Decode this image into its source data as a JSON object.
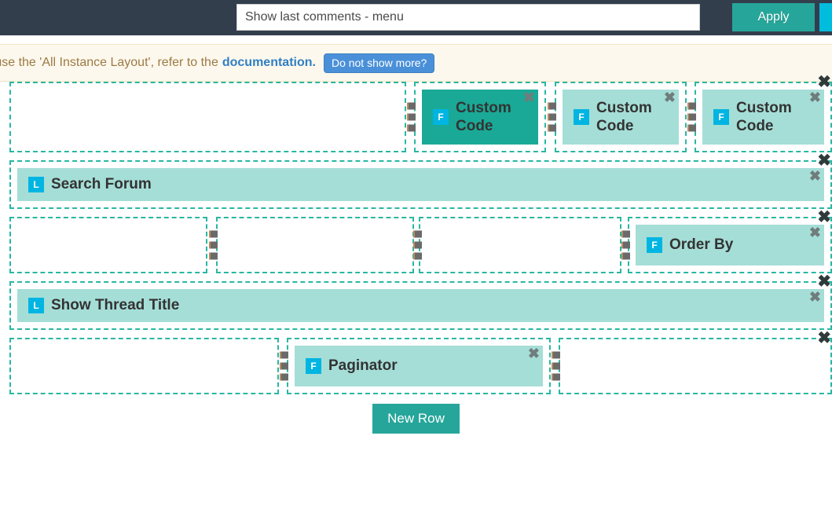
{
  "topbar": {
    "input_value": "Show last comments - menu",
    "input_placeholder": "",
    "apply_label": "Apply",
    "edge_button_label": ""
  },
  "notice": {
    "text": "o use the 'All Instance Layout', refer to the",
    "link_label": "documentation.",
    "dismiss_label": "Do not show more?"
  },
  "builder": {
    "new_row_label": "New Row",
    "close_glyph": "✖",
    "rows": [
      {
        "name": "row-1",
        "columns": [
          {
            "name": "column-empty",
            "widget": null
          },
          {
            "name": "column-custom-code-1",
            "widget": {
              "badge": "F",
              "label": "Custom Code",
              "selected": true
            }
          },
          {
            "name": "column-custom-code-2",
            "widget": {
              "badge": "F",
              "label": "Custom Code",
              "selected": false
            }
          },
          {
            "name": "column-custom-code-3",
            "widget": {
              "badge": "F",
              "label": "Custom Code",
              "selected": false
            }
          }
        ]
      },
      {
        "name": "row-2",
        "columns": [
          {
            "name": "column-search-forum",
            "widget": {
              "badge": "L",
              "label": "Search Forum",
              "selected": false
            }
          }
        ]
      },
      {
        "name": "row-3",
        "columns": [
          {
            "name": "column-empty",
            "widget": null
          },
          {
            "name": "column-empty",
            "widget": null
          },
          {
            "name": "column-empty",
            "widget": null
          },
          {
            "name": "column-order-by",
            "widget": {
              "badge": "F",
              "label": "Order By",
              "selected": false
            }
          }
        ]
      },
      {
        "name": "row-4",
        "columns": [
          {
            "name": "column-show-thread-title",
            "widget": {
              "badge": "L",
              "label": "Show Thread Title",
              "selected": false
            }
          }
        ]
      },
      {
        "name": "row-5",
        "columns": [
          {
            "name": "column-empty",
            "widget": null
          },
          {
            "name": "column-paginator",
            "widget": {
              "badge": "F",
              "label": "Paginator",
              "selected": false
            }
          },
          {
            "name": "column-empty",
            "widget": null
          }
        ]
      }
    ]
  },
  "colors": {
    "topbar_bg": "#333e4d",
    "apply_green": "#26a69a",
    "edge_cyan": "#00bcdd",
    "notice_bg": "#fdf8ed",
    "notice_text": "#9c7a45",
    "notice_link": "#2f7fc4",
    "notice_button": "#4a90d9",
    "dashed_border": "#2ab7a2",
    "widget_light": "#a5ded7",
    "widget_selected": "#1aa996",
    "badge_cyan": "#00b5e2"
  }
}
